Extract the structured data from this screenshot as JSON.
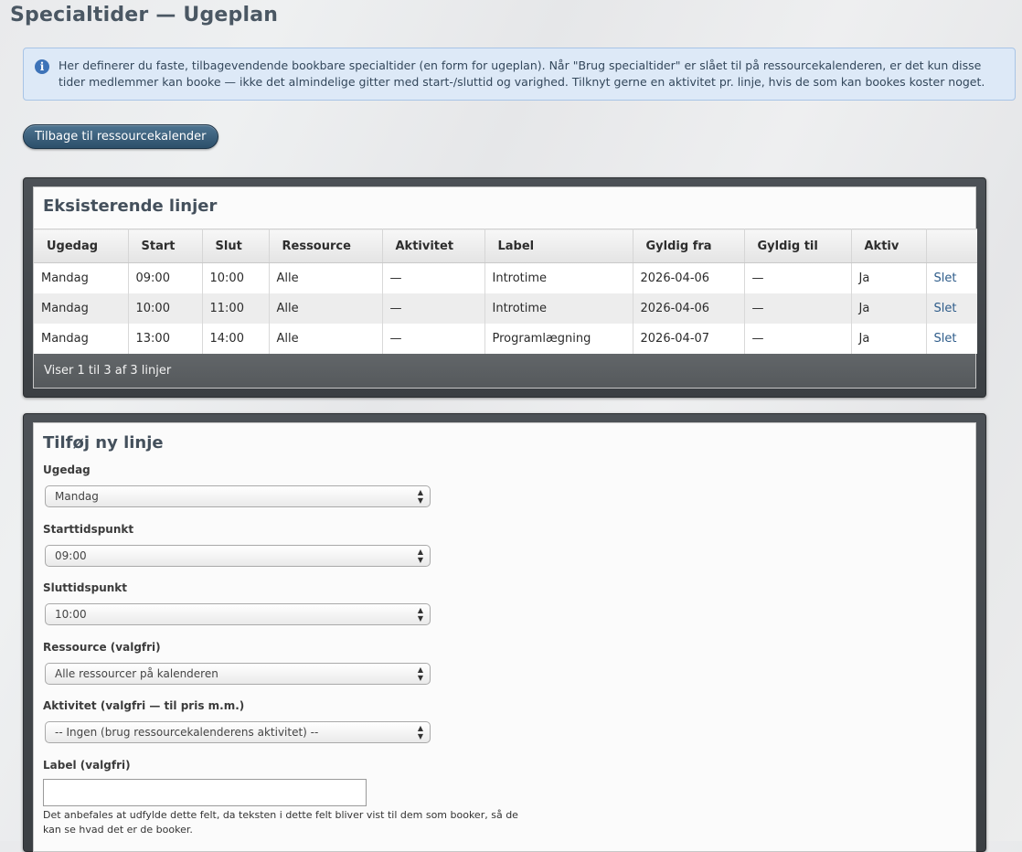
{
  "page": {
    "title": "Specialtider — Ugeplan",
    "info_text": "Her definerer du faste, tilbagevendende bookbare specialtider (en form for ugeplan). Når \"Brug specialtider\" er slået til på ressourcekalenderen, er det kun disse tider medlemmer kan booke — ikke det almindelige gitter med start-/sluttid og varighed. Tilknyt gerne en aktivitet pr. linje, hvis de som kan bookes koster noget.",
    "back_button_label": "Tilbage til ressourcekalender"
  },
  "existing": {
    "heading": "Eksisterende linjer",
    "columns": [
      "Ugedag",
      "Start",
      "Slut",
      "Ressource",
      "Aktivitet",
      "Label",
      "Gyldig fra",
      "Gyldig til",
      "Aktiv",
      ""
    ],
    "rows": [
      [
        "Mandag",
        "09:00",
        "10:00",
        "Alle",
        "—",
        "Introtime",
        "2026-04-06",
        "—",
        "Ja",
        "Slet"
      ],
      [
        "Mandag",
        "10:00",
        "11:00",
        "Alle",
        "—",
        "Introtime",
        "2026-04-06",
        "—",
        "Ja",
        "Slet"
      ],
      [
        "Mandag",
        "13:00",
        "14:00",
        "Alle",
        "—",
        "Programlægning",
        "2026-04-07",
        "—",
        "Ja",
        "Slet"
      ]
    ],
    "footer": "Viser 1 til 3 af 3 linjer"
  },
  "add_form": {
    "heading": "Tilføj ny linje",
    "weekday_label": "Ugedag",
    "weekday_value": "Mandag",
    "start_label": "Starttidspunkt",
    "start_value": "09:00",
    "end_label": "Sluttidspunkt",
    "end_value": "10:00",
    "resource_label": "Ressource (valgfri)",
    "resource_value": "Alle ressourcer på kalenderen",
    "activity_label": "Aktivitet (valgfri — til pris m.m.)",
    "activity_value": "-- Ingen (brug ressourcekalenderens aktivitet) --",
    "label_label": "Label (valgfri)",
    "label_value": "",
    "label_help": "Det anbefales at udfylde dette felt, da teksten i dette felt bliver vist til dem som booker, så de kan se hvad det er de booker."
  },
  "colors": {
    "title": "#4a5763",
    "info_bg": "#dde9f7",
    "panel_dark": "#3f4347",
    "button": "#2c4f6a",
    "link": "#2e5c8a"
  },
  "icons": {
    "info": "info-icon",
    "select_arrows": "up-down-arrow-icon"
  }
}
